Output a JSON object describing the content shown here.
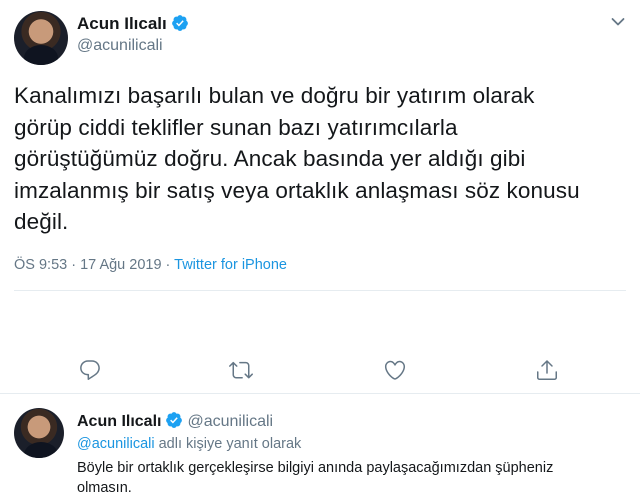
{
  "main_tweet": {
    "author_name": "Acun Ilıcalı",
    "handle": "@acunilicali",
    "text_lines": [
      "Kanalımızı başarılı bulan ve doğru bir yatırım olarak",
      "görüp ciddi teklifler sunan bazı yatırımcılarla",
      "görüştüğümüz doğru. Ancak basında yer aldığı gibi",
      "imzalanmış bir satış veya ortaklık anlaşması söz konusu",
      "değil."
    ],
    "timestamp": "ÖS 9:53 · 17 Ağu 2019 · ",
    "source": "Twitter for iPhone"
  },
  "actions": {
    "reply_icon": "reply-icon",
    "retweet_icon": "retweet-icon",
    "like_icon": "like-icon",
    "share_icon": "share-icon"
  },
  "reply_tweet": {
    "author_name": "Acun Ilıcalı",
    "handle": "@acunilicali",
    "reply_to_mention": "@acunilicali",
    "reply_to_suffix": " adlı kişiye yanıt olarak",
    "text_lines": [
      "Böyle bir ortaklık gerçekleşirse bilgiyi anında paylaşacağımızdan şüpheniz",
      "olmasın."
    ]
  },
  "colors": {
    "accent": "#1b95e0",
    "muted": "#657786",
    "text": "#14171a",
    "divider": "#e6ecf0"
  }
}
